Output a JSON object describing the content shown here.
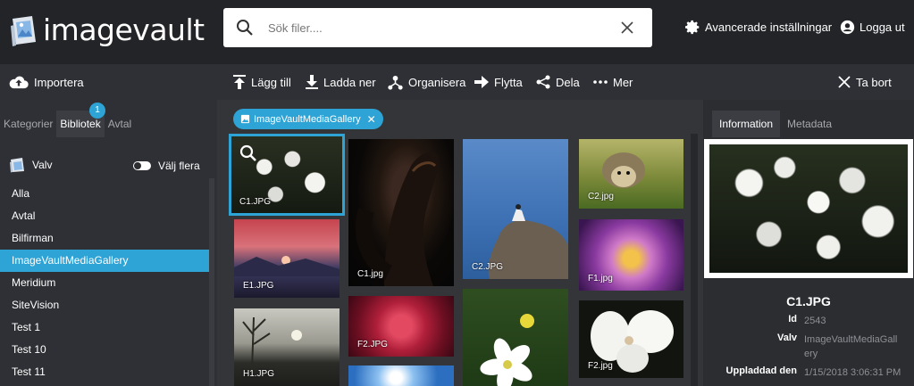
{
  "app": {
    "name": "imagevault"
  },
  "search": {
    "placeholder": "Sök filer...."
  },
  "header": {
    "advanced_settings": "Avancerade inställningar",
    "logout": "Logga ut"
  },
  "toolbar": {
    "import": "Importera",
    "add": "Lägg till",
    "download": "Ladda ner",
    "organize": "Organisera",
    "move": "Flytta",
    "share": "Dela",
    "more": "Mer",
    "delete": "Ta bort"
  },
  "left_panel": {
    "tabs": [
      "Kategorier",
      "Bibliotek",
      "Avtal"
    ],
    "active_tab": "Bibliotek",
    "badge_count": "1",
    "vault_label": "Valv",
    "multi_select_label": "Välj flera",
    "vaults": [
      "Alla",
      "Avtal",
      "Bilfirman",
      "ImageVaultMediaGallery",
      "Meridium",
      "SiteVision",
      "Test 1",
      "Test 10",
      "Test 11"
    ],
    "selected_vault": "ImageVaultMediaGallery"
  },
  "filter_chip": {
    "label": "ImageVaultMediaGallery"
  },
  "thumbnails": [
    {
      "label": "C1.JPG",
      "selected": true
    },
    {
      "label": "E1.JPG"
    },
    {
      "label": "H1.JPG"
    },
    {
      "label": "C1.jpg"
    },
    {
      "label": "F2.JPG"
    },
    {
      "label": "C2.JPG"
    },
    {
      "label": "C2.jpg"
    },
    {
      "label": "F1.jpg"
    },
    {
      "label": "F2.jpg"
    }
  ],
  "right_panel": {
    "tabs": [
      "Information",
      "Metadata"
    ],
    "active_tab": "Information",
    "file_name": "C1.JPG",
    "details": [
      {
        "key": "Id",
        "value": "2543"
      },
      {
        "key": "Valv",
        "value": "ImageVaultMediaGallery"
      },
      {
        "key": "Uppladdad den",
        "value": "1/15/2018 3:06:31 PM"
      }
    ]
  },
  "colors": {
    "accent": "#2ea3d5",
    "header_bg": "#222428",
    "panel_bg": "#2e3035",
    "grid_bg": "#333539"
  }
}
